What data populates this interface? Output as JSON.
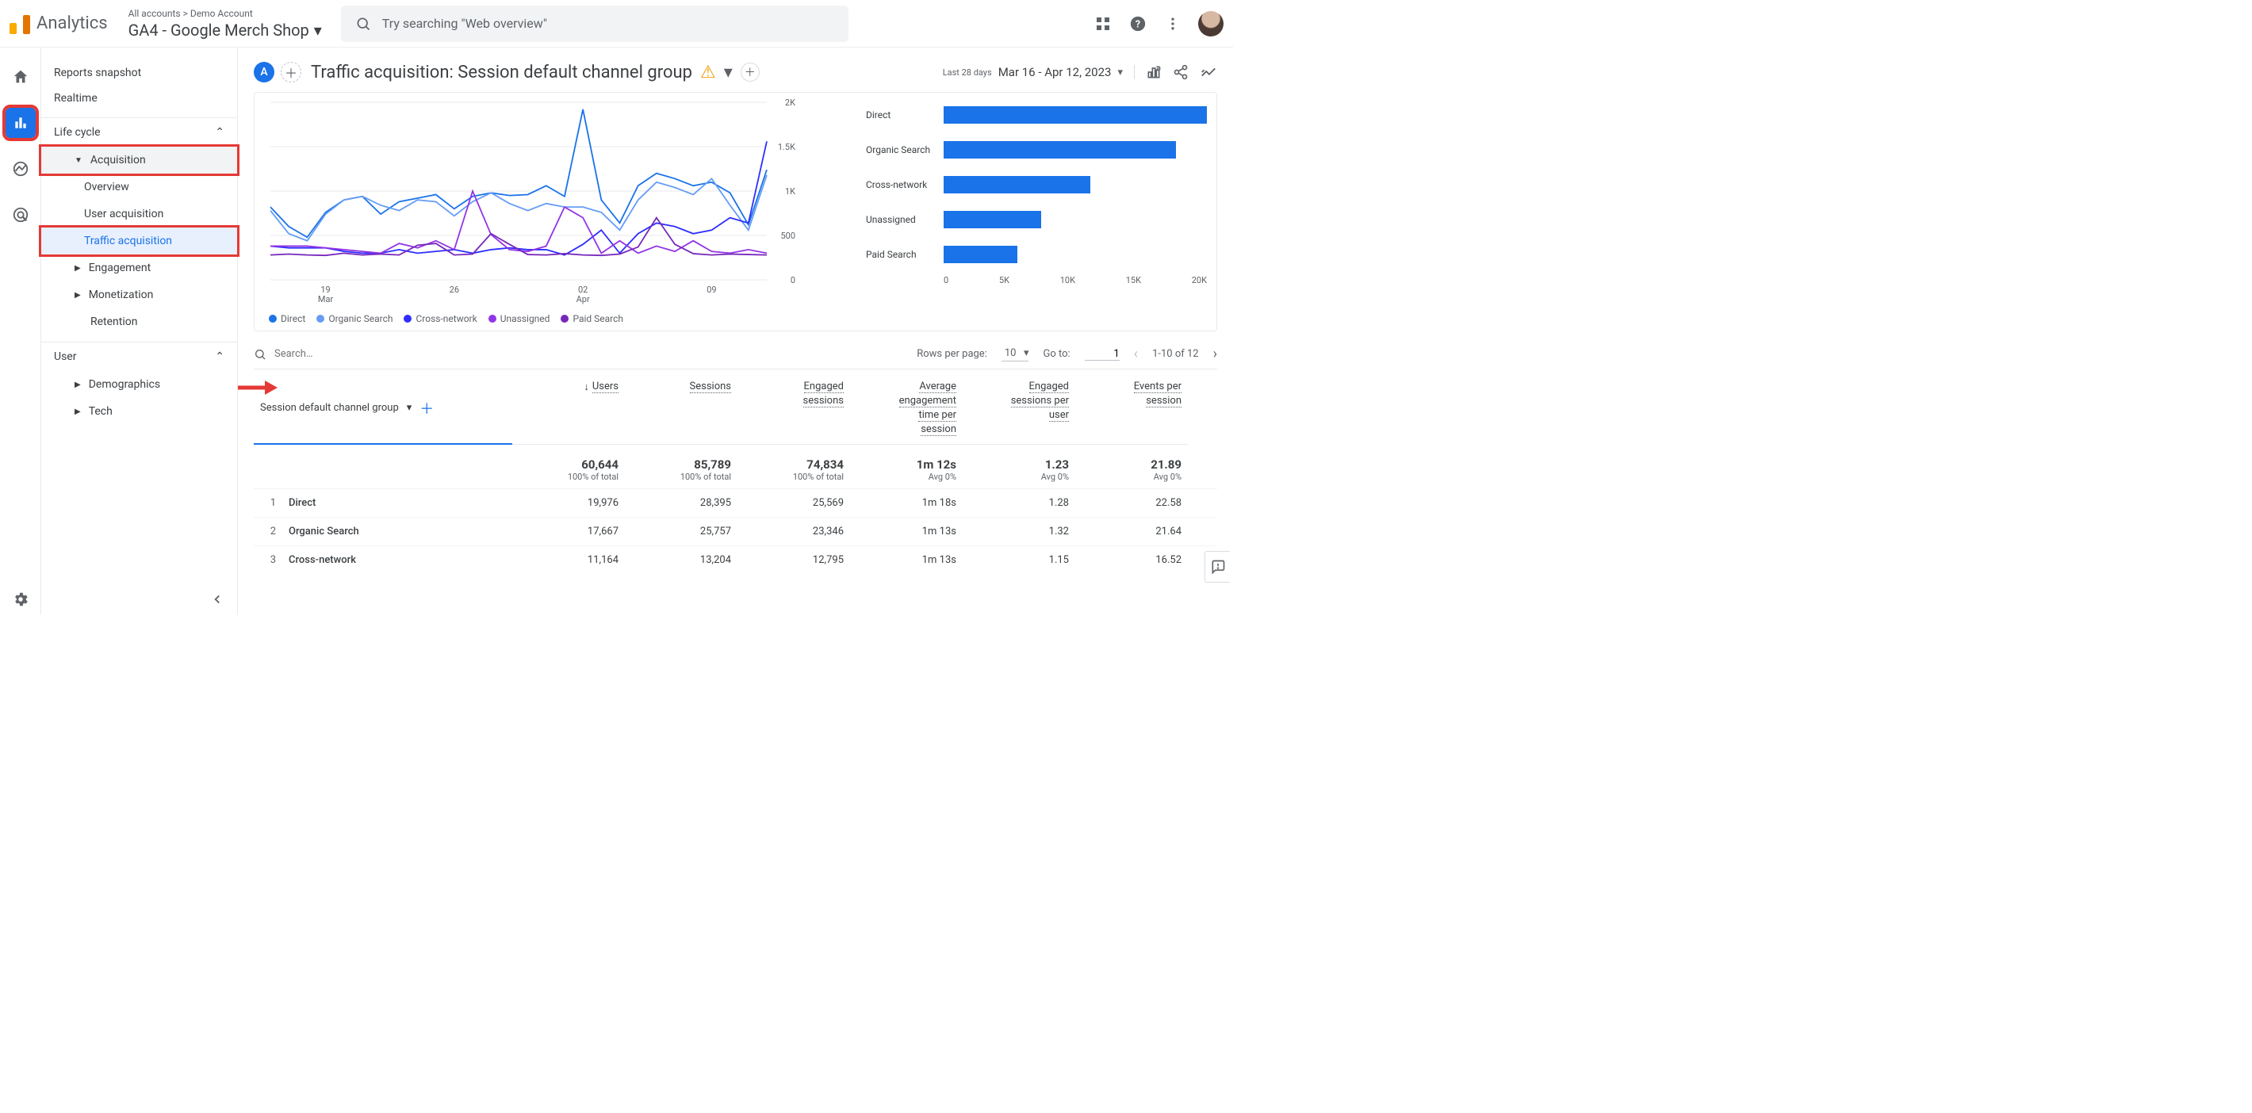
{
  "header": {
    "product": "Analytics",
    "breadcrumb": "All accounts > Demo Account",
    "property": "GA4 - Google Merch Shop",
    "search_placeholder": "Try searching \"Web overview\""
  },
  "nav": {
    "reports_snapshot": "Reports snapshot",
    "realtime": "Realtime",
    "life_cycle": "Life cycle",
    "acquisition": "Acquisition",
    "overview": "Overview",
    "user_acq": "User acquisition",
    "traffic_acq": "Traffic acquisition",
    "engagement": "Engagement",
    "monetization": "Monetization",
    "retention": "Retention",
    "user": "User",
    "demographics": "Demographics",
    "tech": "Tech"
  },
  "page": {
    "segment": "A",
    "title": "Traffic acquisition: Session default channel group",
    "date_label": "Last 28 days",
    "date_range": "Mar 16 - Apr 12, 2023"
  },
  "chart_data": {
    "line": {
      "type": "line",
      "y_ticks": [
        "0",
        "500",
        "1K",
        "1.5K",
        "2K"
      ],
      "x_ticks": [
        "19 Mar",
        "26",
        "02 Apr",
        "09"
      ],
      "ylim": [
        0,
        2000
      ],
      "series": [
        {
          "name": "Direct",
          "color": "#1a73e8",
          "values": [
            820,
            600,
            480,
            760,
            900,
            940,
            740,
            880,
            920,
            960,
            800,
            940,
            980,
            950,
            960,
            1060,
            940,
            1920,
            900,
            640,
            1060,
            1200,
            1140,
            1060,
            1100,
            980,
            620,
            1240
          ]
        },
        {
          "name": "Organic Search",
          "color": "#669df6",
          "values": [
            780,
            520,
            440,
            740,
            900,
            940,
            840,
            780,
            900,
            880,
            720,
            880,
            980,
            860,
            780,
            860,
            820,
            820,
            760,
            560,
            900,
            1100,
            1040,
            960,
            1140,
            840,
            560,
            1180
          ]
        },
        {
          "name": "Cross-network",
          "color": "#2e2eff",
          "values": [
            380,
            360,
            360,
            360,
            320,
            300,
            300,
            340,
            300,
            320,
            340,
            300,
            340,
            360,
            340,
            340,
            280,
            400,
            560,
            300,
            520,
            640,
            600,
            520,
            560,
            700,
            640,
            1560
          ]
        },
        {
          "name": "Unassigned",
          "color": "#9334e6",
          "values": [
            380,
            380,
            380,
            360,
            340,
            320,
            300,
            410,
            360,
            440,
            340,
            1000,
            510,
            340,
            320,
            380,
            820,
            700,
            300,
            440,
            300,
            380,
            320,
            440,
            320,
            300,
            340,
            300
          ]
        },
        {
          "name": "Paid Search",
          "color": "#7627bb",
          "values": [
            280,
            290,
            280,
            275,
            300,
            280,
            290,
            280,
            390,
            410,
            280,
            290,
            520,
            400,
            285,
            280,
            295,
            280,
            275,
            290,
            370,
            700,
            400,
            295,
            280,
            290,
            285,
            280
          ]
        }
      ]
    },
    "bars": {
      "type": "bar",
      "xlim": [
        0,
        20000
      ],
      "x_ticks": [
        "0",
        "5K",
        "10K",
        "15K",
        "20K"
      ],
      "items": [
        {
          "name": "Direct",
          "value": 19976
        },
        {
          "name": "Organic Search",
          "value": 17667
        },
        {
          "name": "Cross-network",
          "value": 11164
        },
        {
          "name": "Unassigned",
          "value": 7400
        },
        {
          "name": "Paid Search",
          "value": 5600
        }
      ]
    }
  },
  "table": {
    "search_placeholder": "Search…",
    "rows_per_page_label": "Rows per page:",
    "rows_per_page": "10",
    "goto_label": "Go to:",
    "goto_value": "1",
    "range": "1-10 of 12",
    "dimension": "Session default channel group",
    "columns": [
      {
        "label": "Users",
        "sorted": true
      },
      {
        "label": "Sessions"
      },
      {
        "label": "Engaged sessions"
      },
      {
        "label": "Average engagement time per session"
      },
      {
        "label": "Engaged sessions per user"
      },
      {
        "label": "Events per session"
      }
    ],
    "totals": {
      "users": {
        "v": "60,644",
        "s": "100% of total"
      },
      "sessions": {
        "v": "85,789",
        "s": "100% of total"
      },
      "engaged": {
        "v": "74,834",
        "s": "100% of total"
      },
      "avg_eng": {
        "v": "1m 12s",
        "s": "Avg 0%"
      },
      "eng_per_user": {
        "v": "1.23",
        "s": "Avg 0%"
      },
      "events": {
        "v": "21.89",
        "s": "Avg 0%"
      }
    },
    "rows": [
      {
        "n": "1",
        "dim": "Direct",
        "users": "19,976",
        "sessions": "28,395",
        "engaged": "25,569",
        "avg": "1m 18s",
        "epu": "1.28",
        "eps": "22.58"
      },
      {
        "n": "2",
        "dim": "Organic Search",
        "users": "17,667",
        "sessions": "25,757",
        "engaged": "23,346",
        "avg": "1m 13s",
        "epu": "1.32",
        "eps": "21.64"
      },
      {
        "n": "3",
        "dim": "Cross-network",
        "users": "11,164",
        "sessions": "13,204",
        "engaged": "12,795",
        "avg": "1m 13s",
        "epu": "1.15",
        "eps": "16.52"
      }
    ]
  }
}
